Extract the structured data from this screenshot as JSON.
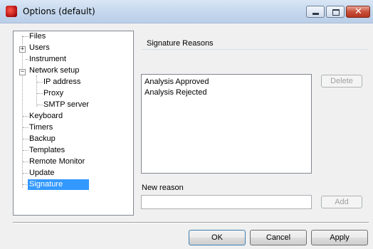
{
  "window": {
    "title": "Options (default)",
    "app_icon": "app-icon",
    "controls": {
      "minimize": "minimize-icon",
      "maximize": "maximize-icon",
      "close": "close-icon",
      "close_glyph": "✕"
    }
  },
  "tree": {
    "items": [
      {
        "label": "Files",
        "expander": null
      },
      {
        "label": "Users",
        "expander": "+"
      },
      {
        "label": "Instrument",
        "expander": null
      },
      {
        "label": "Network setup",
        "expander": "−"
      },
      {
        "label": "IP address",
        "expander": null
      },
      {
        "label": "Proxy",
        "expander": null
      },
      {
        "label": "SMTP server",
        "expander": null
      },
      {
        "label": "Keyboard",
        "expander": null
      },
      {
        "label": "Timers",
        "expander": null
      },
      {
        "label": "Backup",
        "expander": null
      },
      {
        "label": "Templates",
        "expander": null
      },
      {
        "label": "Remote Monitor",
        "expander": null
      },
      {
        "label": "Update",
        "expander": null
      },
      {
        "label": "Signature",
        "expander": null,
        "selected": true
      }
    ]
  },
  "signature_panel": {
    "group_title": "Signature Reasons",
    "reasons": [
      "Analysis Approved",
      "Analysis Rejected"
    ],
    "delete_label": "Delete",
    "new_reason_label": "New reason",
    "new_reason_value": "",
    "add_label": "Add"
  },
  "footer": {
    "ok_label": "OK",
    "cancel_label": "Cancel",
    "apply_label": "Apply"
  },
  "colors": {
    "selection": "#3399ff",
    "titlebar": "#c3d6ec",
    "close_button": "#c8503a"
  }
}
